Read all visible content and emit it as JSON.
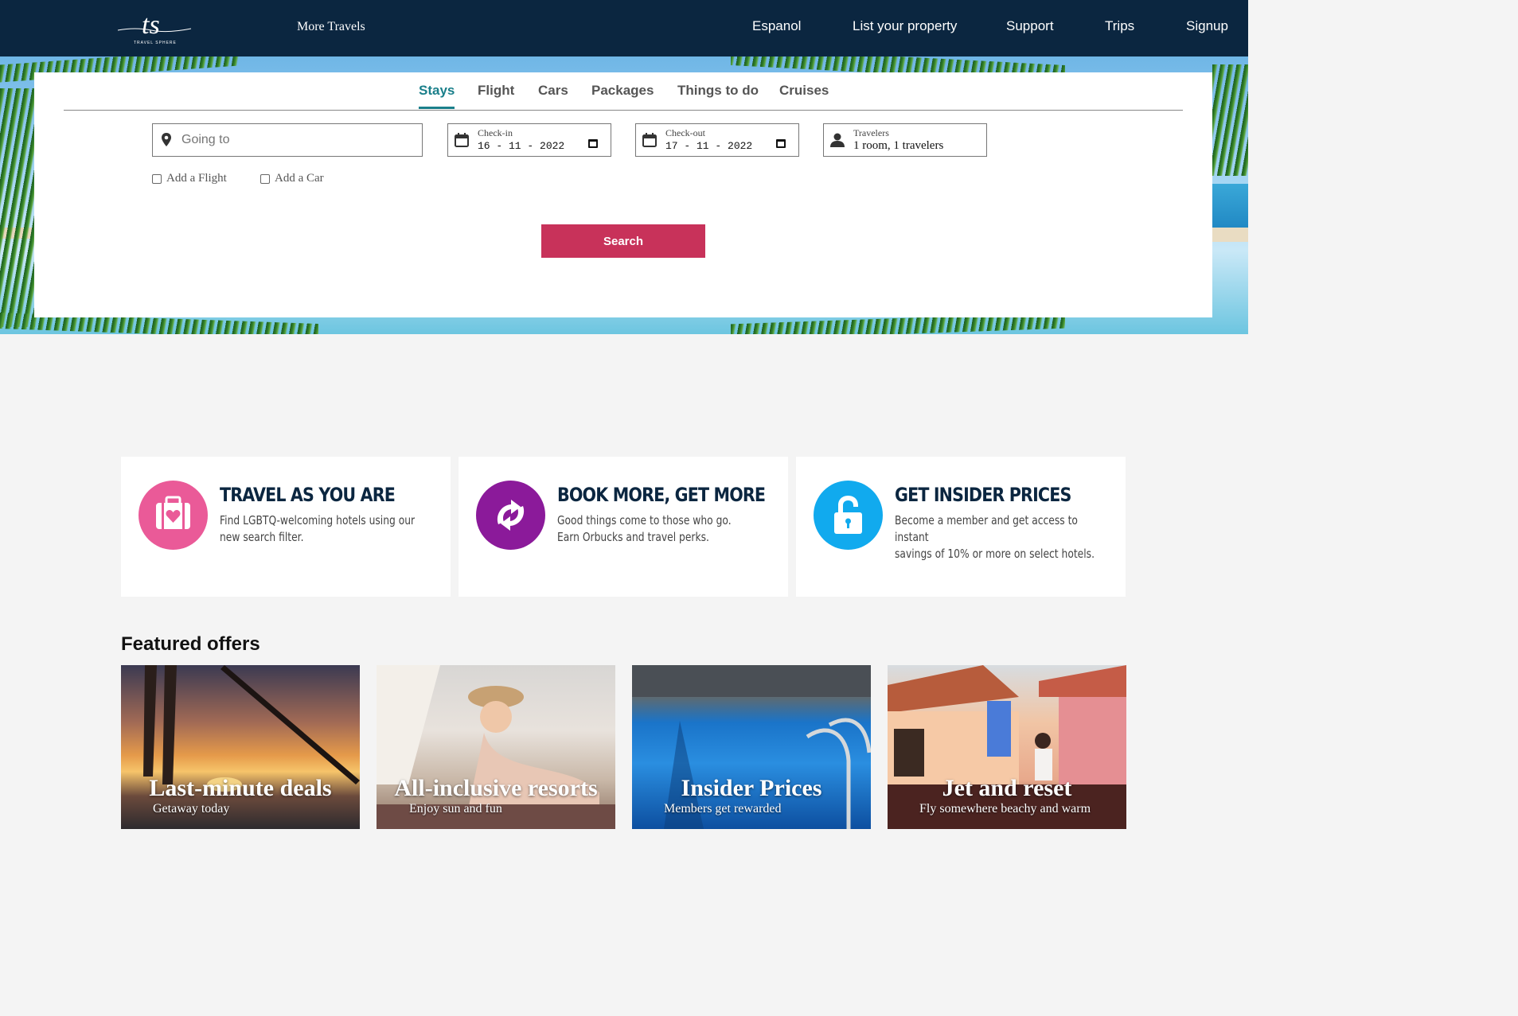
{
  "header": {
    "logo_text": "ts",
    "logo_subtext": "TRAVEL SPHERE",
    "more_travels": "More Travels",
    "nav": [
      "Espanol",
      "List your property",
      "Support",
      "Trips",
      "Signup"
    ]
  },
  "search": {
    "tabs": [
      "Stays",
      "Flight",
      "Cars",
      "Packages",
      "Things to do",
      "Cruises"
    ],
    "active_tab": "Stays",
    "going_to_placeholder": "Going to",
    "checkin_label": "Check-in",
    "checkin_value": "16 - 11 - 2022",
    "checkout_label": "Check-out",
    "checkout_value": "17 - 11 - 2022",
    "travelers_label": "Travelers",
    "travelers_value": "1 room, 1 travelers",
    "add_flight": "Add a Flight",
    "add_car": "Add a Car",
    "search_label": "Search"
  },
  "promos": [
    {
      "title": "TRAVEL AS YOU ARE",
      "line1": "Find LGBTQ-welcoming hotels using our",
      "line2": "new search filter.",
      "color": "#ea5a98",
      "icon": "suitcase-heart-icon"
    },
    {
      "title": "BOOK MORE, GET MORE",
      "line1": "Good things come to those who go.",
      "line2": "Earn Orbucks and travel perks.",
      "color": "#8b1a9a",
      "icon": "refresh-arrows-icon"
    },
    {
      "title": "GET INSIDER PRICES",
      "line1": "Become a member and get access to instant",
      "line2": "savings of 10% or more on select hotels.",
      "color": "#11aaee",
      "icon": "unlock-icon"
    }
  ],
  "featured": {
    "title": "Featured offers",
    "offers": [
      {
        "title": "Last-minute deals",
        "subtitle": "Getaway today"
      },
      {
        "title": "All-inclusive resorts",
        "subtitle": "Enjoy sun and fun"
      },
      {
        "title": "Insider Prices",
        "subtitle": "Members get rewarded"
      },
      {
        "title": "Jet and reset",
        "subtitle": "Fly somewhere beachy and warm"
      }
    ]
  },
  "colors": {
    "header_bg": "#0b2640",
    "accent_teal": "#1a7f8a",
    "search_button": "#c8325a"
  }
}
